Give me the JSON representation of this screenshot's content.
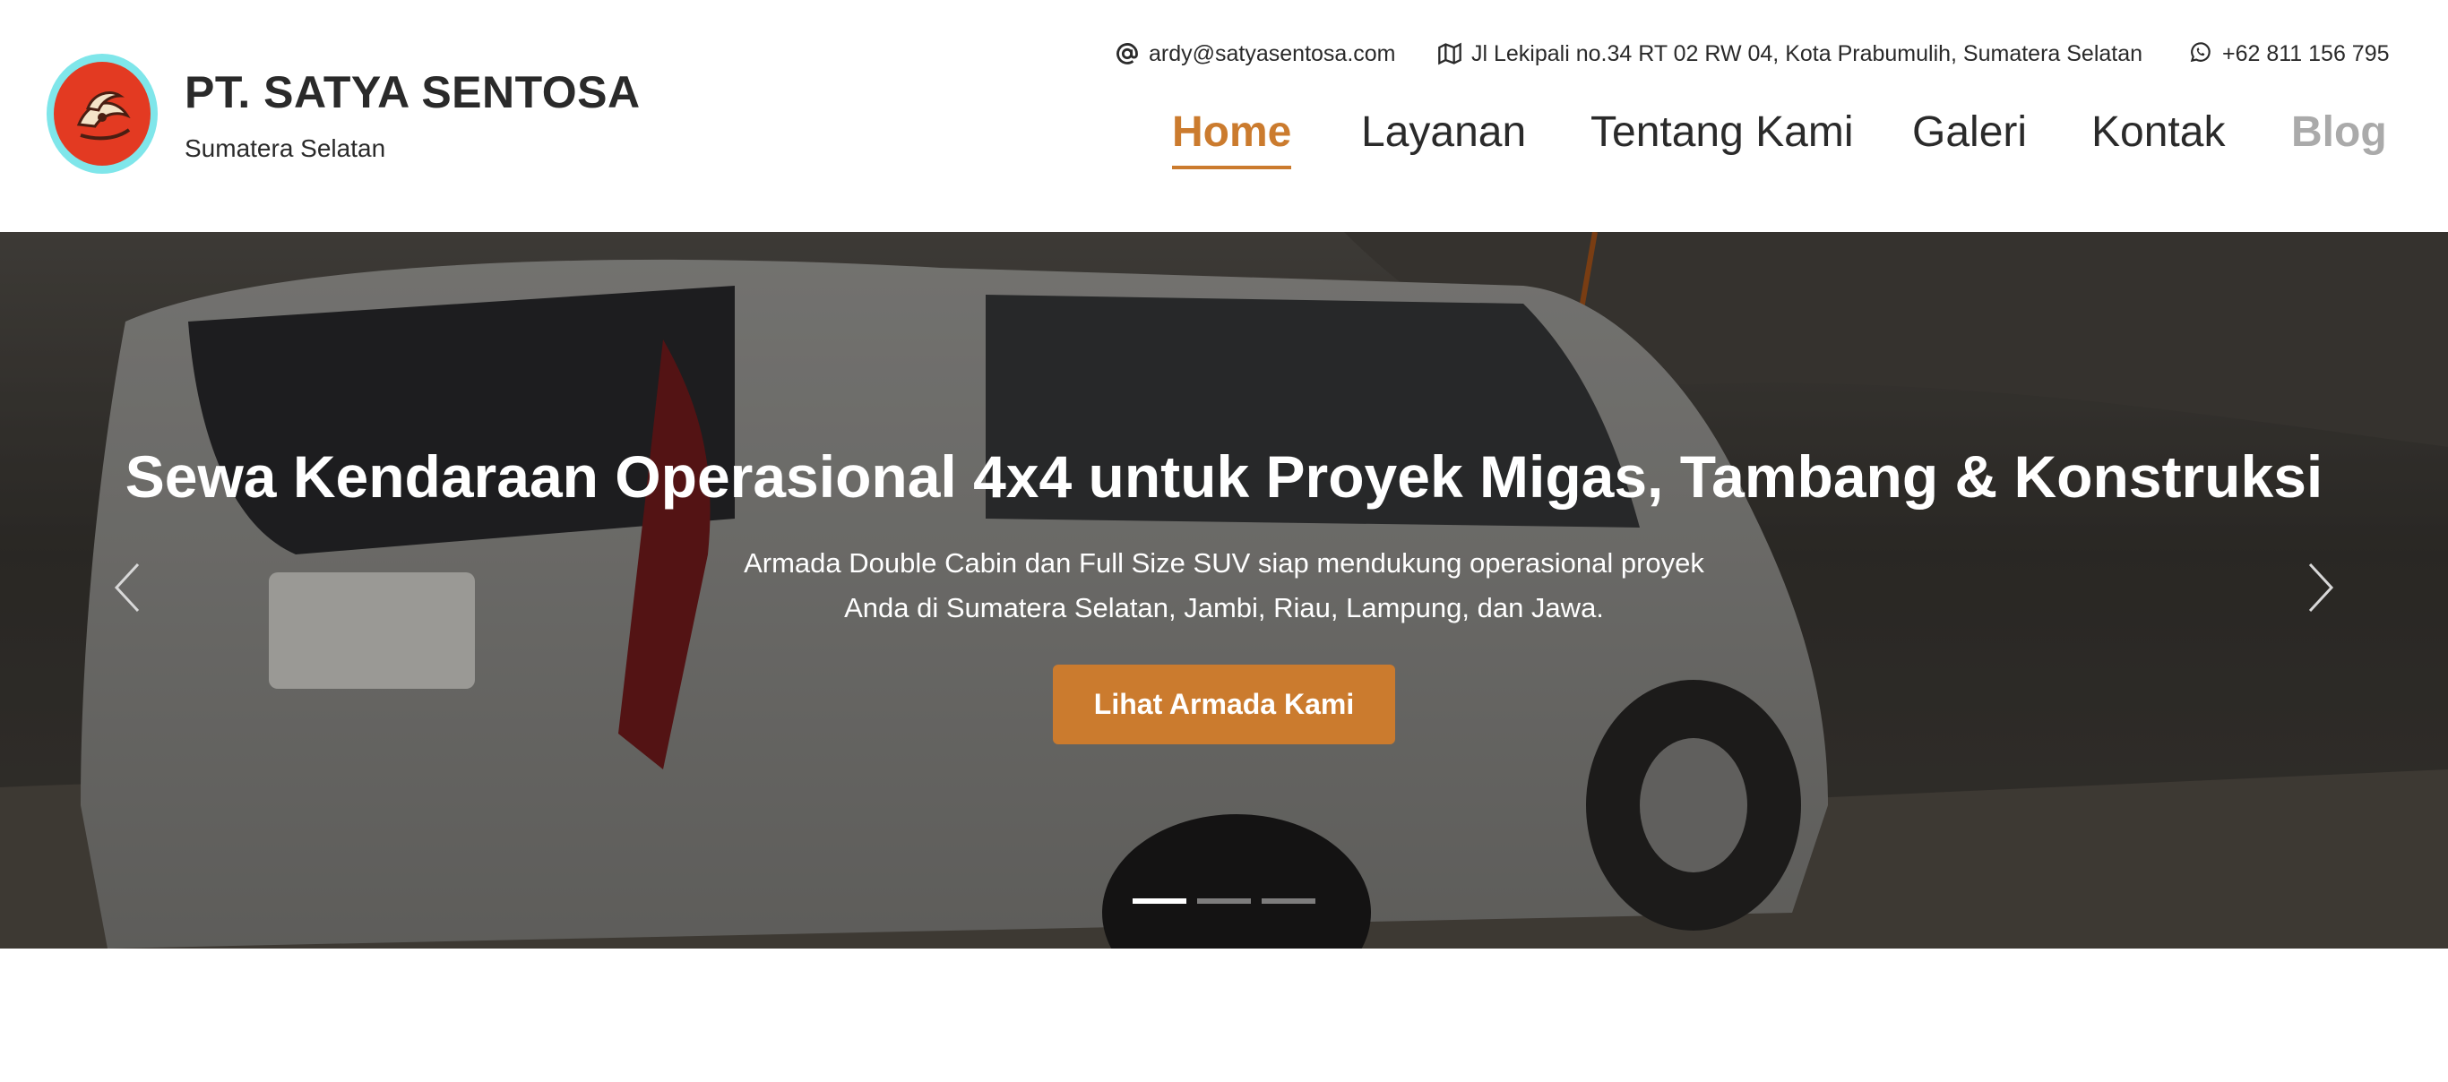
{
  "brand": {
    "name": "PT. SATYA SENTOSA",
    "region": "Sumatera Selatan",
    "logo_icon": "company-logo-emblem"
  },
  "contact": {
    "email": "ardy@satyasentosa.com",
    "email_icon": "at-sign-icon",
    "address": "Jl Lekipali no.34 RT 02 RW 04, Kota Prabumulih, Sumatera Selatan",
    "address_icon": "map-icon",
    "phone": "+62 811 156 795",
    "phone_icon": "whatsapp-icon"
  },
  "nav": {
    "items": [
      {
        "label": "Home",
        "state": "active"
      },
      {
        "label": "Layanan",
        "state": "normal"
      },
      {
        "label": "Tentang Kami",
        "state": "normal"
      },
      {
        "label": "Galeri",
        "state": "normal"
      },
      {
        "label": "Kontak",
        "state": "normal"
      },
      {
        "label": "Blog",
        "state": "muted"
      }
    ]
  },
  "hero": {
    "title": "Sewa Kendaraan Operasional 4x4 untuk Proyek Migas, Tambang & Konstruksi",
    "text_line1": "Armada Double Cabin dan Full Size SUV siap mendukung operasional proyek",
    "text_line2": "Anda di Sumatera Selatan, Jambi, Riau, Lampung, dan Jawa.",
    "cta_label": "Lihat Armada Kami",
    "prev_icon": "chevron-left-icon",
    "next_icon": "chevron-right-icon",
    "slides_count": 3,
    "active_slide": 1
  },
  "colors": {
    "accent": "#cb7b2e",
    "text": "#2a2a2a",
    "muted": "#aaaaaa",
    "logo_red": "#e33a22",
    "logo_ring": "#7fe6ea"
  }
}
